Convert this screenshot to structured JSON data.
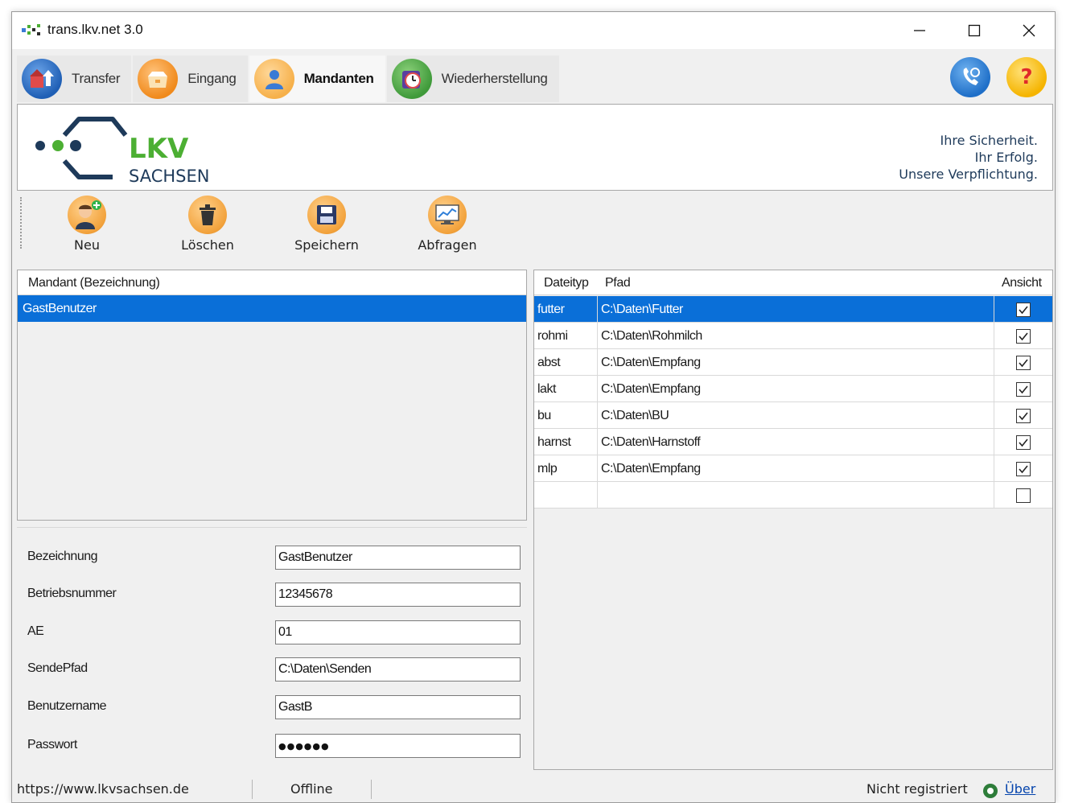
{
  "window": {
    "title": "trans.lkv.net 3.0"
  },
  "tabs": [
    {
      "label": "Transfer",
      "icon": "transfer-icon"
    },
    {
      "label": "Eingang",
      "icon": "inbox-icon"
    },
    {
      "label": "Mandanten",
      "icon": "user-icon",
      "active": true
    },
    {
      "label": "Wiederherstellung",
      "icon": "restore-clock-icon"
    }
  ],
  "top_icons": [
    "phone-support-icon",
    "help-icon"
  ],
  "banner": {
    "logo_text": "LKV",
    "logo_subtext": "SACHSEN",
    "slogan": [
      "Ihre Sicherheit.",
      "Ihr Erfolg.",
      "Unsere Verpflichtung."
    ]
  },
  "toolbar": {
    "new_label": "Neu",
    "delete_label": "Löschen",
    "save_label": "Speichern",
    "query_label": "Abfragen"
  },
  "mandant_list": {
    "header": "Mandant (Bezeichnung)",
    "rows": [
      "GastBenutzer"
    ]
  },
  "form": {
    "bezeichnung_label": "Bezeichnung",
    "bezeichnung_value": "GastBenutzer",
    "betriebsnummer_label": "Betriebsnummer",
    "betriebsnummer_value": "12345678",
    "ae_label": "AE",
    "ae_value": "01",
    "sendepfad_label": "SendePfad",
    "sendepfad_value": "C:\\Daten\\Senden",
    "benutzername_label": "Benutzername",
    "benutzername_value": "GastB",
    "passwort_label": "Passwort",
    "passwort_value": "●●●●●●"
  },
  "file_grid": {
    "headers": {
      "type": "Dateityp",
      "path": "Pfad",
      "view": "Ansicht"
    },
    "rows": [
      {
        "type": "futter",
        "path": "C:\\Daten\\Futter",
        "checked": true
      },
      {
        "type": "rohmi",
        "path": "C:\\Daten\\Rohmilch",
        "checked": true
      },
      {
        "type": "abst",
        "path": "C:\\Daten\\Empfang",
        "checked": true
      },
      {
        "type": "lakt",
        "path": "C:\\Daten\\Empfang",
        "checked": true
      },
      {
        "type": "bu",
        "path": "C:\\Daten\\BU",
        "checked": true
      },
      {
        "type": "harnst",
        "path": "C:\\Daten\\Harnstoff",
        "checked": true
      },
      {
        "type": "mlp",
        "path": "C:\\Daten\\Empfang",
        "checked": true
      },
      {
        "type": "",
        "path": "",
        "checked": false
      }
    ]
  },
  "statusbar": {
    "url": "https://www.lkvsachsen.de",
    "status": "Offline",
    "registration": "Nicht registriert",
    "about_link": "Über"
  },
  "colors": {
    "selection": "#0a6fd8",
    "logo_green": "#4caf33",
    "logo_navy": "#1e3a5a"
  }
}
